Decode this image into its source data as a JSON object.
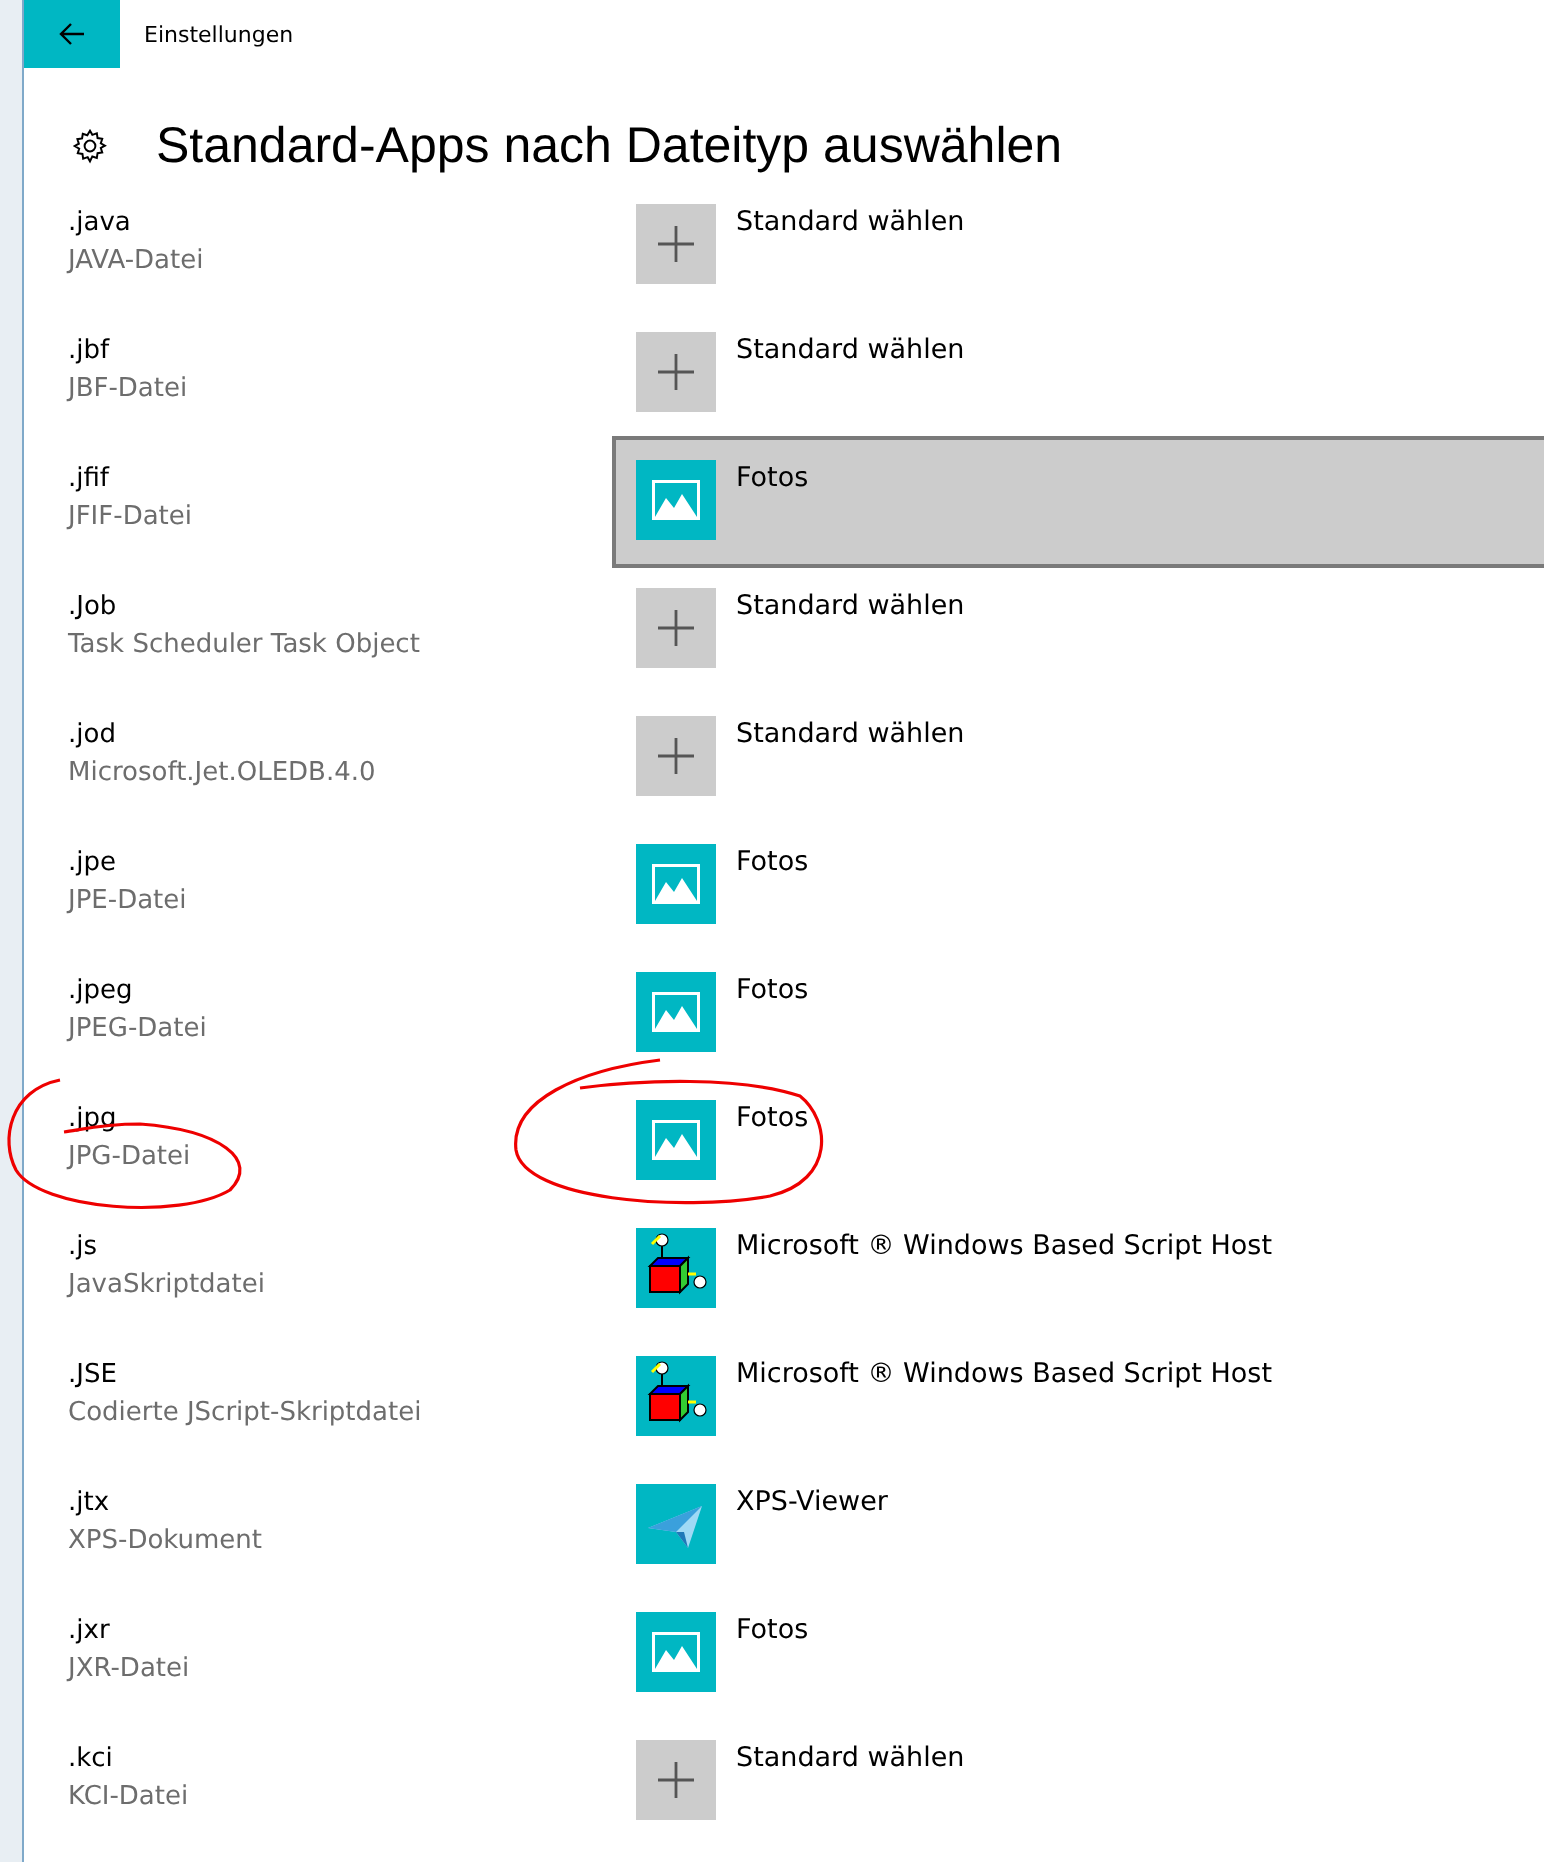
{
  "window": {
    "title": "Einstellungen"
  },
  "page_title": "Standard-Apps nach Dateityp auswählen",
  "rows": [
    {
      "extension": ".java",
      "description": "JAVA-Datei",
      "app": {
        "kind": "plus",
        "label": "Standard wählen"
      },
      "selected": false
    },
    {
      "extension": ".jbf",
      "description": "JBF-Datei",
      "app": {
        "kind": "plus",
        "label": "Standard wählen"
      },
      "selected": false
    },
    {
      "extension": ".jfif",
      "description": "JFIF-Datei",
      "app": {
        "kind": "photos",
        "label": "Fotos"
      },
      "selected": true
    },
    {
      "extension": ".Job",
      "description": "Task Scheduler Task Object",
      "app": {
        "kind": "plus",
        "label": "Standard wählen"
      },
      "selected": false
    },
    {
      "extension": ".jod",
      "description": "Microsoft.Jet.OLEDB.4.0",
      "app": {
        "kind": "plus",
        "label": "Standard wählen"
      },
      "selected": false
    },
    {
      "extension": ".jpe",
      "description": "JPE-Datei",
      "app": {
        "kind": "photos",
        "label": "Fotos"
      },
      "selected": false
    },
    {
      "extension": ".jpeg",
      "description": "JPEG-Datei",
      "app": {
        "kind": "photos",
        "label": "Fotos"
      },
      "selected": false
    },
    {
      "extension": ".jpg",
      "description": "JPG-Datei",
      "app": {
        "kind": "photos",
        "label": "Fotos"
      },
      "selected": false
    },
    {
      "extension": ".js",
      "description": "JavaSkriptdatei",
      "app": {
        "kind": "script",
        "label": "Microsoft ® Windows Based Script Host"
      },
      "selected": false
    },
    {
      "extension": ".JSE",
      "description": "Codierte JScript-Skriptdatei",
      "app": {
        "kind": "script",
        "label": "Microsoft ® Windows Based Script Host"
      },
      "selected": false
    },
    {
      "extension": ".jtx",
      "description": "XPS-Dokument",
      "app": {
        "kind": "xps",
        "label": "XPS-Viewer"
      },
      "selected": false
    },
    {
      "extension": ".jxr",
      "description": "JXR-Datei",
      "app": {
        "kind": "photos",
        "label": "Fotos"
      },
      "selected": false
    },
    {
      "extension": ".kci",
      "description": "KCI-Datei",
      "app": {
        "kind": "plus",
        "label": "Standard wählen"
      },
      "selected": false
    }
  ]
}
